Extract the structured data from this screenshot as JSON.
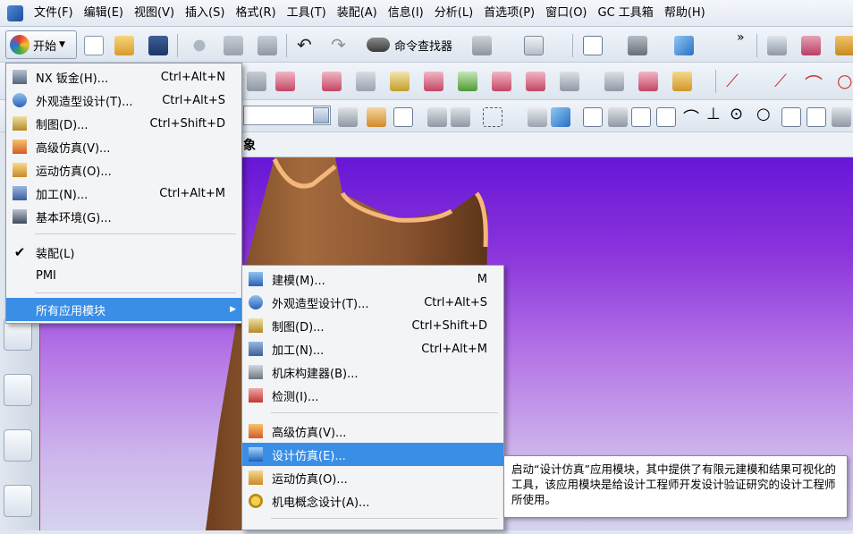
{
  "menubar": {
    "items": [
      "文件(F)",
      "编辑(E)",
      "视图(V)",
      "插入(S)",
      "格式(R)",
      "工具(T)",
      "装配(A)",
      "信息(I)",
      "分析(L)",
      "首选项(P)",
      "窗口(O)",
      "GC 工具箱",
      "帮助(H)"
    ]
  },
  "toolbar": {
    "start_label": "开始",
    "command_finder_label": "命令查找器"
  },
  "viewport": {
    "tab_label": "象"
  },
  "start_menu": {
    "items": [
      {
        "label": "NX 钣金(H)...",
        "shortcut": "Ctrl+Alt+N"
      },
      {
        "label": "外观造型设计(T)...",
        "shortcut": "Ctrl+Alt+S"
      },
      {
        "label": "制图(D)...",
        "shortcut": "Ctrl+Shift+D"
      },
      {
        "label": "高级仿真(V)...",
        "shortcut": ""
      },
      {
        "label": "运动仿真(O)...",
        "shortcut": ""
      },
      {
        "label": "加工(N)...",
        "shortcut": "Ctrl+Alt+M"
      },
      {
        "label": "基本环境(G)...",
        "shortcut": ""
      },
      {
        "label": "装配(L)",
        "shortcut": ""
      },
      {
        "label": "PMI",
        "shortcut": ""
      },
      {
        "label": "所有应用模块",
        "shortcut": ""
      }
    ]
  },
  "all_apps_menu": {
    "items": [
      {
        "label": "建模(M)...",
        "shortcut": "M"
      },
      {
        "label": "外观造型设计(T)...",
        "shortcut": "Ctrl+Alt+S"
      },
      {
        "label": "制图(D)...",
        "shortcut": "Ctrl+Shift+D"
      },
      {
        "label": "加工(N)...",
        "shortcut": "Ctrl+Alt+M"
      },
      {
        "label": "机床构建器(B)...",
        "shortcut": ""
      },
      {
        "label": "检测(I)...",
        "shortcut": ""
      },
      {
        "label": "高级仿真(V)...",
        "shortcut": ""
      },
      {
        "label": "设计仿真(E)...",
        "shortcut": ""
      },
      {
        "label": "运动仿真(O)...",
        "shortcut": ""
      },
      {
        "label": "机电概念设计(A)...",
        "shortcut": ""
      }
    ]
  },
  "tooltip": {
    "text": "启动“设计仿真”应用模块，其中提供了有限元建模和结果可视化的工具，该应用模块是给设计工程师开发设计验证研究的设计工程师所使用。"
  },
  "colors": {
    "selection": "#3a8ee6",
    "viewport_top": "#6616d6",
    "part": "#8f5a34"
  }
}
